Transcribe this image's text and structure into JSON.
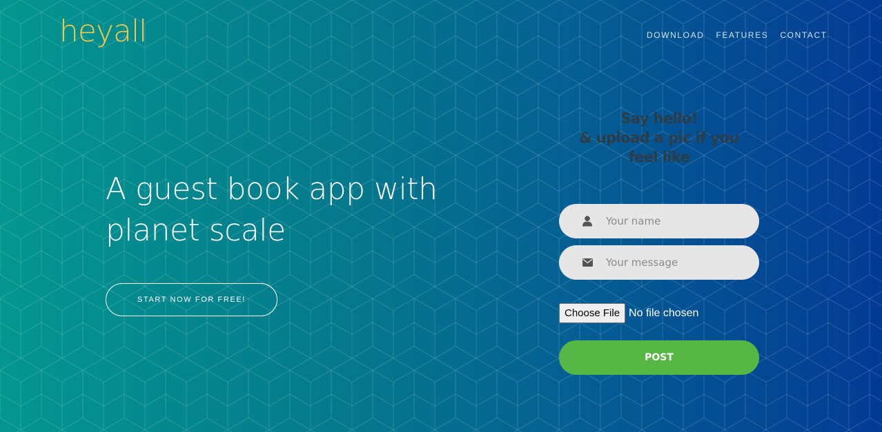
{
  "brand": {
    "logo_text": "heyall",
    "logo_color": "#f2c94c"
  },
  "nav": {
    "items": [
      {
        "label": "DOWNLOAD"
      },
      {
        "label": "FEATURES"
      },
      {
        "label": "CONTACT"
      }
    ]
  },
  "hero": {
    "title_line1": "A guest book app with",
    "title_line2": "planet scale",
    "cta_label": "START NOW FOR FREE!"
  },
  "form": {
    "heading_line1": "Say hello!",
    "heading_line2": "& upload a pic if you",
    "heading_line3": "feel like",
    "name_placeholder": "Your name",
    "name_icon": "user-icon",
    "message_placeholder": "Your message",
    "message_icon": "envelope-icon",
    "file_button_label": "Choose File",
    "file_status": "No file chosen",
    "post_label": "POST",
    "post_color": "#57b745"
  },
  "colors": {
    "gradient_start": "#04968f",
    "gradient_end": "#033a94",
    "field_bg": "#e6e6e6"
  }
}
